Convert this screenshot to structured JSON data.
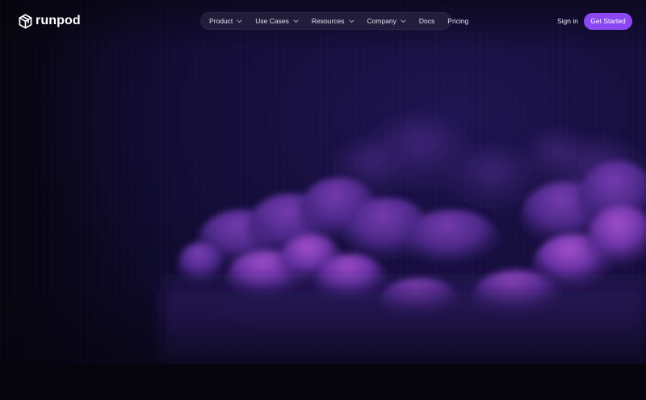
{
  "brand": {
    "name": "runpod",
    "logo_icon": "cube-icon"
  },
  "nav": {
    "items": [
      {
        "label": "Product",
        "dropdown": true
      },
      {
        "label": "Use Cases",
        "dropdown": true
      },
      {
        "label": "Resources",
        "dropdown": true
      },
      {
        "label": "Company",
        "dropdown": true
      },
      {
        "label": "Docs",
        "dropdown": false
      },
      {
        "label": "Pricing",
        "dropdown": false
      }
    ]
  },
  "header": {
    "sign_in_label": "Sign in",
    "cta_label": "Get Started"
  },
  "colors": {
    "accent": "#8a47f2",
    "background": "#07050e",
    "nav_pill": "#2c2846"
  }
}
